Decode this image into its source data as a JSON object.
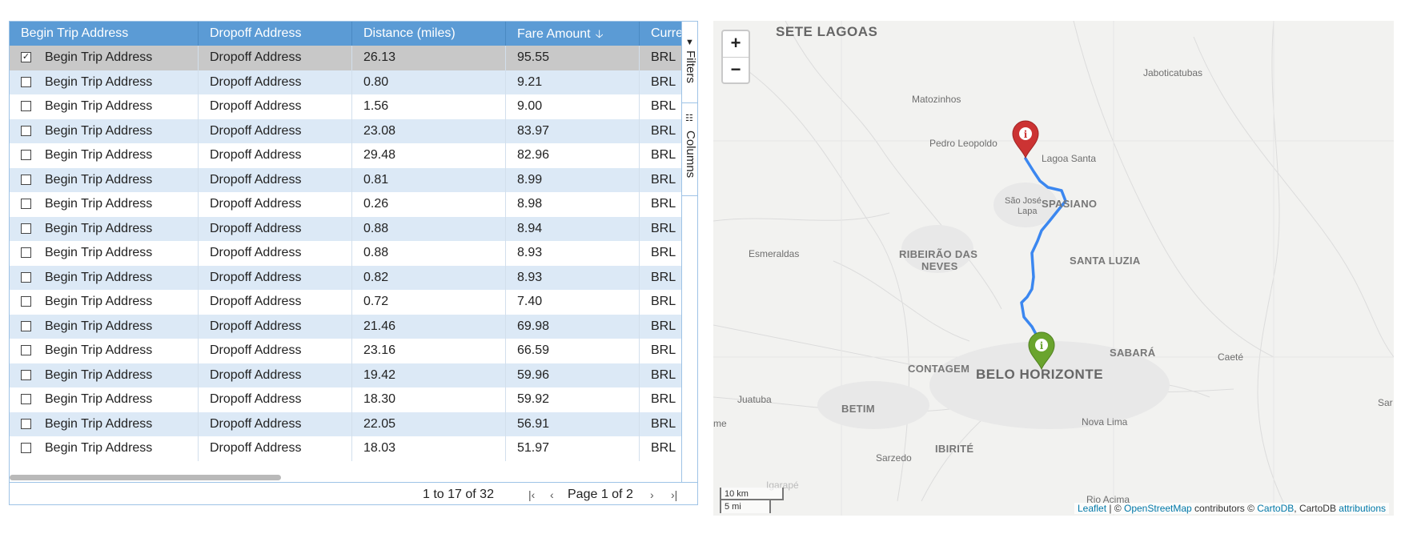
{
  "grid": {
    "columns": [
      {
        "label": "Begin Trip Address"
      },
      {
        "label": "Dropoff Address"
      },
      {
        "label": "Distance (miles)"
      },
      {
        "label": "Fare Amount"
      },
      {
        "label": "Currency"
      }
    ],
    "sort_icon": "arrow-down-icon",
    "checkbox_checked_glyph": "☑",
    "rows": [
      {
        "begin": "Begin Trip Address",
        "dropoff": "Dropoff Address",
        "distance": "26.13",
        "fare": "95.55",
        "currency": "BRL",
        "selected": true
      },
      {
        "begin": "Begin Trip Address",
        "dropoff": "Dropoff Address",
        "distance": "0.80",
        "fare": "9.21",
        "currency": "BRL"
      },
      {
        "begin": "Begin Trip Address",
        "dropoff": "Dropoff Address",
        "distance": "1.56",
        "fare": "9.00",
        "currency": "BRL"
      },
      {
        "begin": "Begin Trip Address",
        "dropoff": "Dropoff Address",
        "distance": "23.08",
        "fare": "83.97",
        "currency": "BRL"
      },
      {
        "begin": "Begin Trip Address",
        "dropoff": "Dropoff Address",
        "distance": "29.48",
        "fare": "82.96",
        "currency": "BRL"
      },
      {
        "begin": "Begin Trip Address",
        "dropoff": "Dropoff Address",
        "distance": "0.81",
        "fare": "8.99",
        "currency": "BRL"
      },
      {
        "begin": "Begin Trip Address",
        "dropoff": "Dropoff Address",
        "distance": "0.26",
        "fare": "8.98",
        "currency": "BRL"
      },
      {
        "begin": "Begin Trip Address",
        "dropoff": "Dropoff Address",
        "distance": "0.88",
        "fare": "8.94",
        "currency": "BRL"
      },
      {
        "begin": "Begin Trip Address",
        "dropoff": "Dropoff Address",
        "distance": "0.88",
        "fare": "8.93",
        "currency": "BRL"
      },
      {
        "begin": "Begin Trip Address",
        "dropoff": "Dropoff Address",
        "distance": "0.82",
        "fare": "8.93",
        "currency": "BRL"
      },
      {
        "begin": "Begin Trip Address",
        "dropoff": "Dropoff Address",
        "distance": "0.72",
        "fare": "7.40",
        "currency": "BRL"
      },
      {
        "begin": "Begin Trip Address",
        "dropoff": "Dropoff Address",
        "distance": "21.46",
        "fare": "69.98",
        "currency": "BRL"
      },
      {
        "begin": "Begin Trip Address",
        "dropoff": "Dropoff Address",
        "distance": "23.16",
        "fare": "66.59",
        "currency": "BRL"
      },
      {
        "begin": "Begin Trip Address",
        "dropoff": "Dropoff Address",
        "distance": "19.42",
        "fare": "59.96",
        "currency": "BRL"
      },
      {
        "begin": "Begin Trip Address",
        "dropoff": "Dropoff Address",
        "distance": "18.30",
        "fare": "59.92",
        "currency": "BRL"
      },
      {
        "begin": "Begin Trip Address",
        "dropoff": "Dropoff Address",
        "distance": "22.05",
        "fare": "56.91",
        "currency": "BRL"
      },
      {
        "begin": "Begin Trip Address",
        "dropoff": "Dropoff Address",
        "distance": "18.03",
        "fare": "51.97",
        "currency": "BRL"
      }
    ],
    "footer": {
      "count_text": "1 to 17 of 32",
      "page_text": "Page 1 of 2",
      "first_icon": "|‹",
      "prev_icon": "‹",
      "next_icon": "›",
      "last_icon": "›|"
    },
    "side_tabs": [
      {
        "label": "Filters",
        "icon": "filter-icon"
      },
      {
        "label": "Columns",
        "icon": "columns-icon"
      }
    ]
  },
  "map": {
    "zoom_in": "+",
    "zoom_out": "−",
    "scale_km": "10 km",
    "scale_mi": "5 mi",
    "attribution": {
      "leaflet": "Leaflet",
      "sep": " | © ",
      "osm": "OpenStreetMap",
      "contrib": " contributors © ",
      "cartodb": "CartoDB",
      "comma": ", CartoDB ",
      "attributions": "attributions"
    },
    "places": {
      "sete_lagoas": "SETE LAGOAS",
      "jaboticatubas": "Jaboticatubas",
      "matozinhos": "Matozinhos",
      "pedro_leopoldo": "Pedro Leopoldo",
      "lagoa_santa": "Lagoa Santa",
      "sao_jose_1": "São José",
      "sao_jose_2": "Lapa",
      "vespasiano": "SPASIANO",
      "esmeraldas": "Esmeraldas",
      "ribeirao_1": "RIBEIRÃO DAS",
      "ribeirao_2": "NEVES",
      "santa_luzia": "SANTA LUZIA",
      "sabara": "SABARÁ",
      "caete": "Caeté",
      "contagem": "CONTAGEM",
      "belo_horizonte": "BELO HORIZONTE",
      "juatuba": "Juatuba",
      "betim": "BETIM",
      "nova_lima": "Nova Lima",
      "me": "me",
      "ibirite": "IBIRITÉ",
      "sarzedo": "Sarzedo",
      "igarape": "Igarapé",
      "rio_acima": "Rio Acima",
      "sar": "Sar"
    },
    "start_marker": {
      "color": "#6aa42e",
      "icon": "info-icon"
    },
    "end_marker": {
      "color": "#cc3333",
      "icon": "info-icon"
    },
    "route_color": "#3b87f0"
  }
}
